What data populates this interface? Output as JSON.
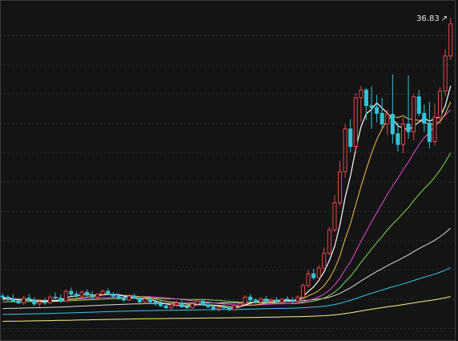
{
  "chart_data": {
    "type": "candlestick",
    "annotations": {
      "max_price_label": "36.83",
      "max_arrow": "↗"
    },
    "ylim": [
      4,
      38
    ],
    "grid": true,
    "colors": {
      "background": "#141414",
      "up": "#e5484d",
      "down": "#33c3d6",
      "ma5": "#ffffff",
      "ma10": "#f2c14e",
      "ma20": "#e84bd8",
      "ma30": "#7ddb4a",
      "ma60": "#d9d9d9",
      "ma120": "#36c4ee",
      "ma250": "#f2f28a"
    },
    "candles": [
      {
        "o": 8.2,
        "h": 8.5,
        "l": 7.8,
        "c": 8.1
      },
      {
        "o": 8.1,
        "h": 8.3,
        "l": 7.7,
        "c": 7.9
      },
      {
        "o": 7.9,
        "h": 8.4,
        "l": 7.6,
        "c": 7.7
      },
      {
        "o": 7.7,
        "h": 8.0,
        "l": 7.4,
        "c": 7.5
      },
      {
        "o": 7.5,
        "h": 8.2,
        "l": 7.3,
        "c": 8.0
      },
      {
        "o": 8.0,
        "h": 8.4,
        "l": 7.7,
        "c": 7.8
      },
      {
        "o": 7.8,
        "h": 8.1,
        "l": 7.2,
        "c": 7.4
      },
      {
        "o": 7.4,
        "h": 7.9,
        "l": 7.1,
        "c": 7.6
      },
      {
        "o": 7.6,
        "h": 8.0,
        "l": 7.3,
        "c": 7.5
      },
      {
        "o": 7.5,
        "h": 8.3,
        "l": 7.4,
        "c": 8.1
      },
      {
        "o": 8.1,
        "h": 8.6,
        "l": 7.9,
        "c": 8.0
      },
      {
        "o": 8.0,
        "h": 8.4,
        "l": 7.5,
        "c": 7.7
      },
      {
        "o": 7.7,
        "h": 8.9,
        "l": 7.6,
        "c": 8.7
      },
      {
        "o": 8.7,
        "h": 9.1,
        "l": 8.2,
        "c": 8.4
      },
      {
        "o": 8.4,
        "h": 8.7,
        "l": 8.0,
        "c": 8.2
      },
      {
        "o": 8.2,
        "h": 8.8,
        "l": 8.0,
        "c": 8.6
      },
      {
        "o": 8.6,
        "h": 8.9,
        "l": 8.1,
        "c": 8.3
      },
      {
        "o": 8.3,
        "h": 8.7,
        "l": 7.9,
        "c": 8.1
      },
      {
        "o": 8.1,
        "h": 8.5,
        "l": 7.8,
        "c": 8.4
      },
      {
        "o": 8.4,
        "h": 8.9,
        "l": 8.2,
        "c": 8.7
      },
      {
        "o": 8.7,
        "h": 9.0,
        "l": 8.3,
        "c": 8.4
      },
      {
        "o": 8.4,
        "h": 8.6,
        "l": 8.0,
        "c": 8.2
      },
      {
        "o": 8.2,
        "h": 8.5,
        "l": 7.8,
        "c": 8.0
      },
      {
        "o": 8.0,
        "h": 8.3,
        "l": 7.6,
        "c": 7.8
      },
      {
        "o": 7.8,
        "h": 8.4,
        "l": 7.7,
        "c": 8.2
      },
      {
        "o": 8.2,
        "h": 8.5,
        "l": 7.9,
        "c": 8.0
      },
      {
        "o": 8.0,
        "h": 8.2,
        "l": 7.5,
        "c": 7.6
      },
      {
        "o": 7.6,
        "h": 8.0,
        "l": 7.4,
        "c": 7.9
      },
      {
        "o": 7.9,
        "h": 8.2,
        "l": 7.5,
        "c": 7.6
      },
      {
        "o": 7.6,
        "h": 7.9,
        "l": 7.2,
        "c": 7.4
      },
      {
        "o": 7.4,
        "h": 7.8,
        "l": 7.1,
        "c": 7.2
      },
      {
        "o": 7.2,
        "h": 7.6,
        "l": 6.9,
        "c": 7.0
      },
      {
        "o": 7.0,
        "h": 7.5,
        "l": 6.8,
        "c": 7.3
      },
      {
        "o": 7.3,
        "h": 7.7,
        "l": 7.1,
        "c": 7.5
      },
      {
        "o": 7.5,
        "h": 7.8,
        "l": 7.0,
        "c": 7.1
      },
      {
        "o": 7.1,
        "h": 7.4,
        "l": 6.9,
        "c": 7.0
      },
      {
        "o": 7.0,
        "h": 7.6,
        "l": 6.9,
        "c": 7.4
      },
      {
        "o": 7.4,
        "h": 7.9,
        "l": 7.2,
        "c": 7.7
      },
      {
        "o": 7.7,
        "h": 7.9,
        "l": 7.2,
        "c": 7.3
      },
      {
        "o": 7.3,
        "h": 7.6,
        "l": 7.0,
        "c": 7.1
      },
      {
        "o": 7.1,
        "h": 7.3,
        "l": 6.8,
        "c": 6.9
      },
      {
        "o": 6.9,
        "h": 7.2,
        "l": 6.6,
        "c": 7.1
      },
      {
        "o": 7.1,
        "h": 7.4,
        "l": 6.9,
        "c": 7.0
      },
      {
        "o": 7.0,
        "h": 7.2,
        "l": 6.7,
        "c": 6.8
      },
      {
        "o": 6.8,
        "h": 7.3,
        "l": 6.7,
        "c": 7.2
      },
      {
        "o": 7.2,
        "h": 7.6,
        "l": 7.0,
        "c": 7.4
      },
      {
        "o": 7.4,
        "h": 8.3,
        "l": 7.3,
        "c": 8.1
      },
      {
        "o": 8.1,
        "h": 8.4,
        "l": 7.6,
        "c": 7.8
      },
      {
        "o": 7.8,
        "h": 8.0,
        "l": 7.4,
        "c": 7.6
      },
      {
        "o": 7.6,
        "h": 8.1,
        "l": 7.5,
        "c": 7.9
      },
      {
        "o": 7.9,
        "h": 8.2,
        "l": 7.5,
        "c": 7.7
      },
      {
        "o": 7.7,
        "h": 8.0,
        "l": 7.4,
        "c": 7.8
      },
      {
        "o": 7.8,
        "h": 8.1,
        "l": 7.5,
        "c": 7.6
      },
      {
        "o": 7.6,
        "h": 8.0,
        "l": 7.4,
        "c": 7.9
      },
      {
        "o": 7.9,
        "h": 8.2,
        "l": 7.6,
        "c": 7.8
      },
      {
        "o": 7.8,
        "h": 8.1,
        "l": 7.5,
        "c": 7.7
      },
      {
        "o": 7.7,
        "h": 8.3,
        "l": 7.6,
        "c": 8.1
      },
      {
        "o": 8.1,
        "h": 9.5,
        "l": 8.0,
        "c": 9.3
      },
      {
        "o": 9.3,
        "h": 10.9,
        "l": 9.1,
        "c": 10.5
      },
      {
        "o": 10.5,
        "h": 11.0,
        "l": 9.9,
        "c": 10.1
      },
      {
        "o": 10.1,
        "h": 11.4,
        "l": 10.0,
        "c": 11.1
      },
      {
        "o": 11.1,
        "h": 13.2,
        "l": 11.0,
        "c": 12.6
      },
      {
        "o": 12.6,
        "h": 15.3,
        "l": 12.4,
        "c": 15.0
      },
      {
        "o": 15.0,
        "h": 18.6,
        "l": 14.8,
        "c": 17.8
      },
      {
        "o": 17.8,
        "h": 22.1,
        "l": 17.5,
        "c": 21.0
      },
      {
        "o": 21.0,
        "h": 25.9,
        "l": 20.4,
        "c": 25.4
      },
      {
        "o": 25.4,
        "h": 26.4,
        "l": 23.0,
        "c": 23.6
      },
      {
        "o": 23.6,
        "h": 29.1,
        "l": 22.9,
        "c": 28.6
      },
      {
        "o": 28.6,
        "h": 29.8,
        "l": 26.1,
        "c": 29.4
      },
      {
        "o": 29.4,
        "h": 29.6,
        "l": 26.3,
        "c": 27.8
      },
      {
        "o": 27.8,
        "h": 29.8,
        "l": 25.4,
        "c": 27.6
      },
      {
        "o": 27.6,
        "h": 28.9,
        "l": 26.1,
        "c": 27.0
      },
      {
        "o": 27.0,
        "h": 28.6,
        "l": 25.5,
        "c": 25.9
      },
      {
        "o": 25.9,
        "h": 27.4,
        "l": 24.8,
        "c": 26.9
      },
      {
        "o": 26.9,
        "h": 31.0,
        "l": 23.9,
        "c": 24.9
      },
      {
        "o": 24.9,
        "h": 26.1,
        "l": 23.1,
        "c": 23.8
      },
      {
        "o": 23.8,
        "h": 26.6,
        "l": 22.9,
        "c": 25.9
      },
      {
        "o": 25.9,
        "h": 30.9,
        "l": 24.4,
        "c": 25.1
      },
      {
        "o": 25.1,
        "h": 29.0,
        "l": 24.2,
        "c": 28.7
      },
      {
        "o": 28.7,
        "h": 29.4,
        "l": 26.7,
        "c": 27.0
      },
      {
        "o": 27.0,
        "h": 27.9,
        "l": 25.1,
        "c": 26.0
      },
      {
        "o": 26.0,
        "h": 28.2,
        "l": 23.4,
        "c": 24.1
      },
      {
        "o": 24.1,
        "h": 28.0,
        "l": 23.7,
        "c": 26.6
      },
      {
        "o": 26.6,
        "h": 29.7,
        "l": 25.9,
        "c": 29.3
      },
      {
        "o": 29.3,
        "h": 33.6,
        "l": 28.8,
        "c": 32.9
      },
      {
        "o": 32.9,
        "h": 36.83,
        "l": 32.5,
        "c": 36.2
      }
    ]
  }
}
